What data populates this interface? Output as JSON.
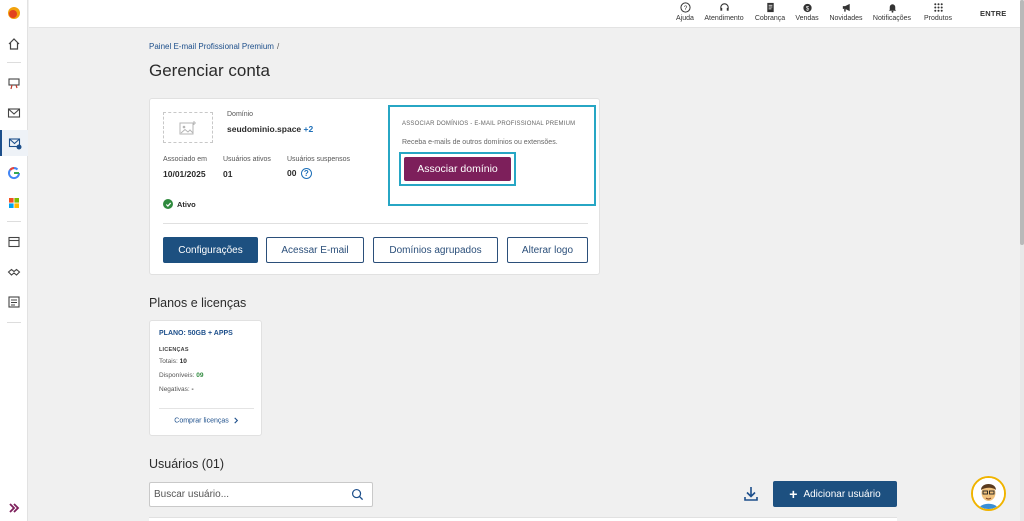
{
  "topbar": {
    "items": [
      {
        "label": "Ajuda",
        "icon": "help-circle-icon"
      },
      {
        "label": "Atendimento",
        "icon": "headset-icon"
      },
      {
        "label": "Cobrança",
        "icon": "invoice-icon"
      },
      {
        "label": "Vendas",
        "icon": "money-bag-icon"
      },
      {
        "label": "Novidades",
        "icon": "megaphone-icon"
      },
      {
        "label": "Notificações",
        "icon": "bell-icon"
      },
      {
        "label": "Produtos",
        "icon": "grid-icon"
      }
    ],
    "entre": "ENTRE"
  },
  "breadcrumb": {
    "item": "Painel E-mail Profissional Premium",
    "separator": "/"
  },
  "page_title": "Gerenciar conta",
  "account": {
    "domain_label": "Domínio",
    "domain_value": "seudominio.space",
    "domain_extra": "+2",
    "associated_label": "Associado em",
    "associated_value": "10/01/2025",
    "active_users_label": "Usuários ativos",
    "active_users_value": "01",
    "suspended_users_label": "Usuários suspensos",
    "suspended_users_value": "00",
    "help_glyph": "?",
    "status": "Ativo"
  },
  "associate": {
    "title": "ASSOCIAR DOMÍNIOS - E-MAIL PROFISSIONAL PREMIUM",
    "description": "Receba e-mails de outros domínios ou extensões.",
    "button": "Associar domínio"
  },
  "actions": {
    "settings": "Configurações",
    "access_email": "Acessar E-mail",
    "grouped_domains": "Domínios agrupados",
    "change_logo": "Alterar logo"
  },
  "plans": {
    "section_title": "Planos e licenças",
    "plan_name": "PLANO: 50GB + APPS",
    "licenses_label": "LICENÇAS",
    "total_label": "Totais:",
    "total_value": "10",
    "available_label": "Disponíveis:",
    "available_value": "09",
    "negative_label": "Negativas:",
    "negative_value": "-",
    "buy_link": "Comprar licenças"
  },
  "users": {
    "section_title": "Usuários (01)",
    "search_placeholder": "Buscar usuário...",
    "add_button": "Adicionar usuário",
    "add_glyph": "+"
  },
  "colors": {
    "primary": "#1d5080",
    "accent_purple": "#7d1f5b",
    "highlight": "#27a6c4",
    "success": "#2f8a3e"
  }
}
